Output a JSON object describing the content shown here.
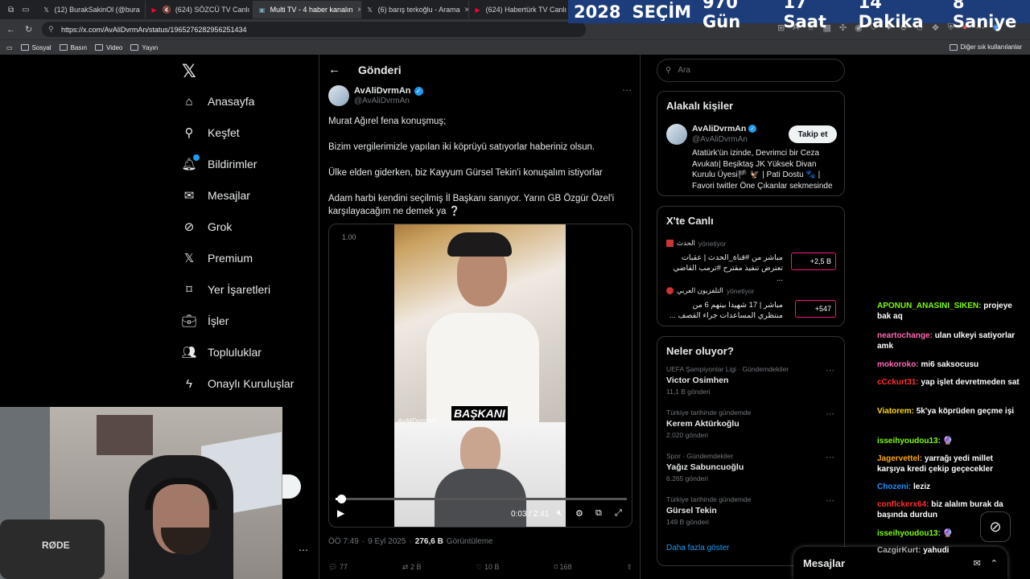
{
  "tabs": [
    {
      "title": "(12) BurakSakinOl (@bura",
      "icon": "x-icon"
    },
    {
      "title": "(624) SÖZCÜ TV Canlı",
      "icon": "youtube-icon"
    },
    {
      "title": "Multi TV - 4 haber kanalın",
      "icon": "tv-icon"
    },
    {
      "title": "(6) barış terkoğlu - Arama",
      "icon": "x-icon"
    },
    {
      "title": "(624) Habertürk TV Canlı",
      "icon": "youtube-icon"
    }
  ],
  "countdown": {
    "year": "2028",
    "label": "SEÇİM",
    "days": "970 Gün",
    "hours": "17 Saat",
    "minutes": "14 Dakika",
    "seconds": "8 Saniye"
  },
  "address": {
    "url": "https://x.com/AvAliDvrmAn/status/1965276282956251434"
  },
  "bookmarks": [
    {
      "label": "Sosyal"
    },
    {
      "label": "Basın"
    },
    {
      "label": "Video"
    },
    {
      "label": "Yayın"
    }
  ],
  "other_bookmarks": "Diğer sık kullanılanlar",
  "nav": [
    {
      "label": "Anasayfa",
      "icon": "home-icon"
    },
    {
      "label": "Keşfet",
      "icon": "search-icon"
    },
    {
      "label": "Bildirimler",
      "icon": "bell-icon"
    },
    {
      "label": "Mesajlar",
      "icon": "mail-icon"
    },
    {
      "label": "Grok",
      "icon": "grok-icon"
    },
    {
      "label": "Premium",
      "icon": "x-icon"
    },
    {
      "label": "Yer İşaretleri",
      "icon": "bookmark-icon"
    },
    {
      "label": "İşler",
      "icon": "briefcase-icon"
    },
    {
      "label": "Topluluklar",
      "icon": "people-icon"
    },
    {
      "label": "Onaylı Kuruluşlar",
      "icon": "lightning-icon"
    }
  ],
  "post": {
    "header": "Gönderi",
    "author": "AvAliDvrmAn",
    "handle": "@AvAliDvrmAn",
    "paragraphs": [
      "Murat Ağırel fena konuşmuş;",
      "Bizim vergilerimizle yapılan iki köprüyü satıyorlar haberiniz olsun.",
      "Ülke elden giderken, biz Kayyum Gürsel Tekin'i konuşalım istiyorlar",
      "Adam harbi kendini seçilmiş İl Başkanı sanıyor. Yarın GB Özgür Özel'i karşılayacağım ne demek ya ❔"
    ],
    "video": {
      "speed": "1.00",
      "caption": "BAŞKANI",
      "watermark": "AvAliDvrmAn",
      "time": "0:03 / 2:41",
      "progress": 0.02
    },
    "meta": {
      "time": "ÖÖ 7:49",
      "date": "9 Eyl 2025",
      "views": "276,6 B",
      "views_label": "Görüntüleme"
    },
    "actions": {
      "replies": "77",
      "reposts": "2 B",
      "likes": "10 B",
      "bookmarks": "168"
    }
  },
  "search": {
    "placeholder": "Ara"
  },
  "related": {
    "title": "Alakalı kişiler",
    "name": "AvAliDvrmAn",
    "handle": "@AvAliDvrmAn",
    "follow_label": "Takip et",
    "bio": "Atatürk'ün izinde, Devrimci bir Ceza Avukatı| Beşiktaş JK Yüksek Divan Kurulu Üyesi🏴 🦅 | Pati Dostu 🐾 | Favori twitler Öne Çıkanlar sekmesinde"
  },
  "live": {
    "title": "X'te Canlı",
    "items": [
      {
        "host": "الحدث",
        "role": "yönetiyor",
        "text": "مباشر من #قناة_الحدث | عقبات تعترض تنفيذ مقترح #ترمب القاضي ...",
        "count": "+2,5 B"
      },
      {
        "host": "التلفزيون العربي",
        "role": "yönetiyor",
        "text": "مباشر | 17 شهيدا بينهم 6 من منتظري المساعدات جراء القصف ...",
        "count": "+547"
      }
    ]
  },
  "trends": {
    "title": "Neler oluyor?",
    "items": [
      {
        "category": "UEFA Şampiyonlar Ligi · Gündemdekiler",
        "name": "Victor Osimhen",
        "count": "11,1 B gönderi"
      },
      {
        "category": "Türkiye tarihinde gündemde",
        "name": "Kerem Aktürkoğlu",
        "count": "2.020 gönderi"
      },
      {
        "category": "Spor · Gündemdekiler",
        "name": "Yağız Sabuncuoğlu",
        "count": "6.265 gönderi"
      },
      {
        "category": "Türkiye tarihinde gündemde",
        "name": "Gürsel Tekin",
        "count": "149 B gönderi"
      }
    ],
    "more_label": "Daha fazla göster"
  },
  "messages_drawer": {
    "label": "Mesajlar"
  },
  "chat": [
    {
      "user": "APONUN_ANASINI_SIKEN:",
      "text": "projeye bak aq",
      "color": "#7CFC00"
    },
    {
      "user": "neartochange:",
      "text": "ulan ulkeyi satiyorlar amk",
      "color": "#FF69B4"
    },
    {
      "user": "mokoroko:",
      "text": "mi6 saksocusu",
      "color": "#FF69B4"
    },
    {
      "user": "cCckurt31:",
      "text": "yap işlet devretmeden sat",
      "color": "#FF3030"
    },
    {
      "user": "Viatorem:",
      "text": "5k'ya köprüden geçme işi",
      "color": "#FFD700"
    },
    {
      "user": "isseihyoudou13:",
      "text": "🔮",
      "color": "#7CFC00"
    },
    {
      "user": "Jagervettel:",
      "text": "yarrağı yedi millet karşıya kredi çekip geçecekler",
      "color": "#FFA500"
    },
    {
      "user": "Chozeni:",
      "text": "leziz",
      "color": "#1E90FF"
    },
    {
      "user": "conflckerx64:",
      "text": "biz alalım burak da başında durdun",
      "color": "#FF3030"
    },
    {
      "user": "isseihyoudou13:",
      "text": "🔮",
      "color": "#7CFC00"
    },
    {
      "user": "CazgirKurt:",
      "text": "yahudi",
      "color": "#b0b0b0"
    }
  ],
  "webcam": {
    "mic_brand": "RØDE"
  }
}
